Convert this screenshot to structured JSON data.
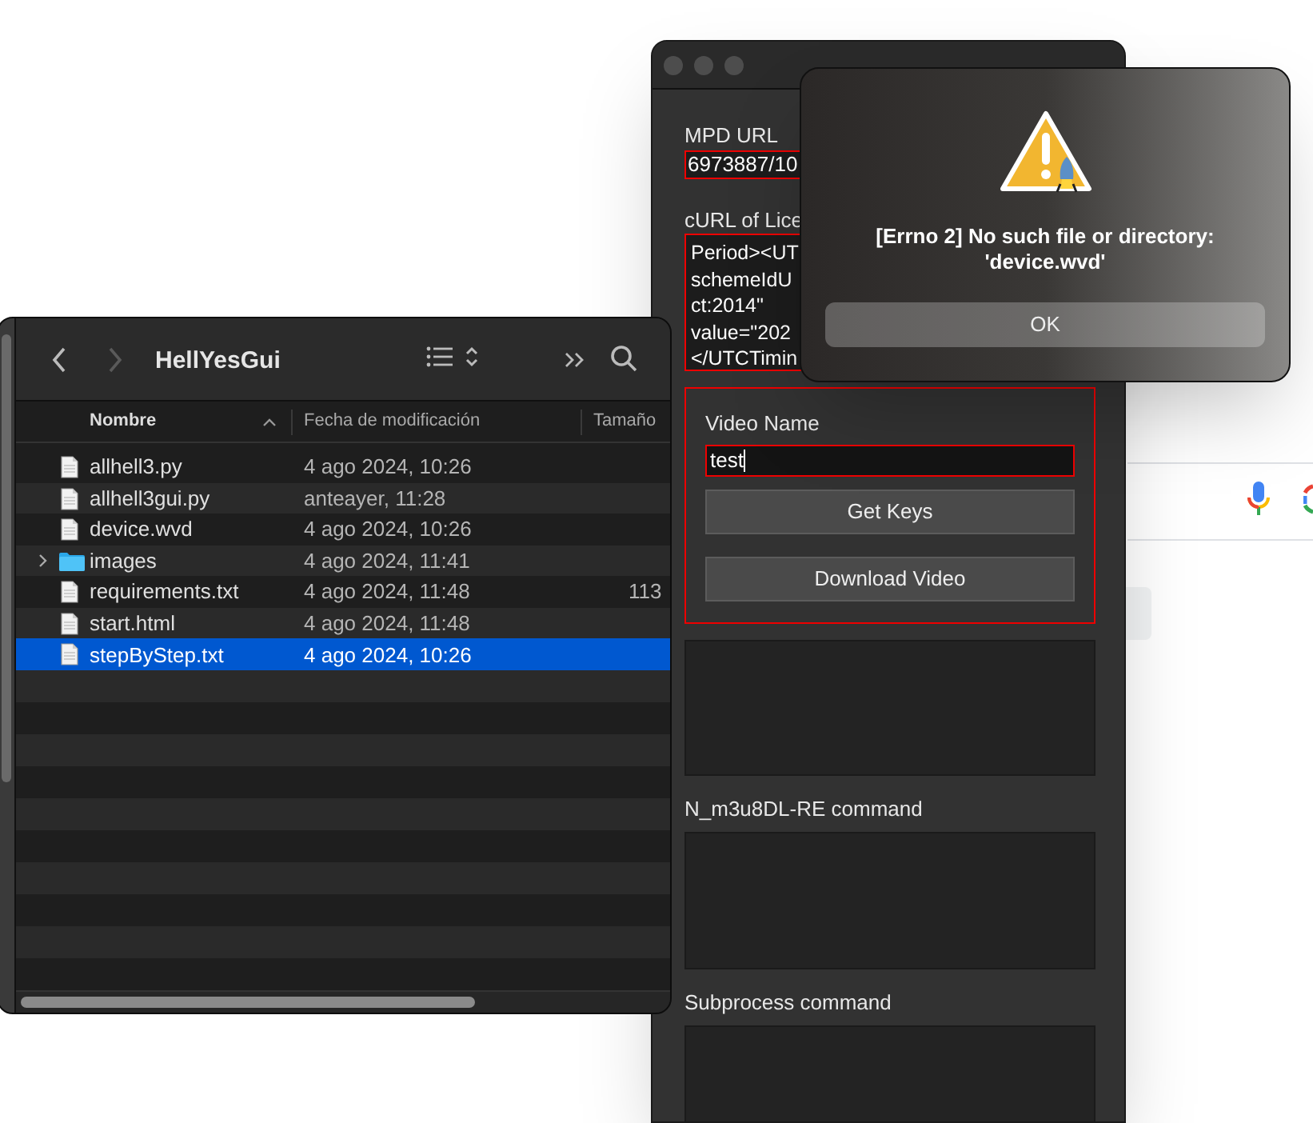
{
  "finder": {
    "title": "HellYesGui",
    "columns": [
      "Nombre",
      "Fecha de modificación",
      "Tamaño"
    ],
    "rows": [
      {
        "kind": "file",
        "name": "allhell3.py",
        "modified": "4 ago 2024, 10:26",
        "selected": false
      },
      {
        "kind": "file",
        "name": "allhell3gui.py",
        "modified": "anteayer, 11:28",
        "selected": false
      },
      {
        "kind": "file",
        "name": "device.wvd",
        "modified": "4 ago 2024, 10:26",
        "selected": false
      },
      {
        "kind": "folder",
        "name": "images",
        "modified": "4 ago 2024, 11:41",
        "expanded": false,
        "selected": false
      },
      {
        "kind": "file",
        "name": "requirements.txt",
        "modified": "4 ago 2024, 11:48",
        "size": "113",
        "selected": false
      },
      {
        "kind": "file",
        "name": "start.html",
        "modified": "4 ago 2024, 11:48",
        "selected": false
      },
      {
        "kind": "file",
        "name": "stepByStep.txt",
        "modified": "4 ago 2024, 10:26",
        "selected": true
      }
    ]
  },
  "gui_window": {
    "mpd_url": {
      "label": "MPD URL",
      "value": "6973887/10"
    },
    "curl": {
      "label": "cURL of Lice",
      "lines": [
        "Period><UT",
        "schemeIdU",
        "ct:2014\"",
        "value=\"202",
        "</UTCTimin"
      ]
    },
    "video_name": {
      "label": "Video Name",
      "value": "test"
    },
    "buttons": [
      "Get Keys",
      "Download Video"
    ],
    "output_labels": [
      "N_m3u8DL-RE command",
      "Subprocess command"
    ]
  },
  "dialog": {
    "message_lines": [
      "[Errno 2] No such file or directory:",
      "'device.wvd'"
    ],
    "button": "OK"
  }
}
